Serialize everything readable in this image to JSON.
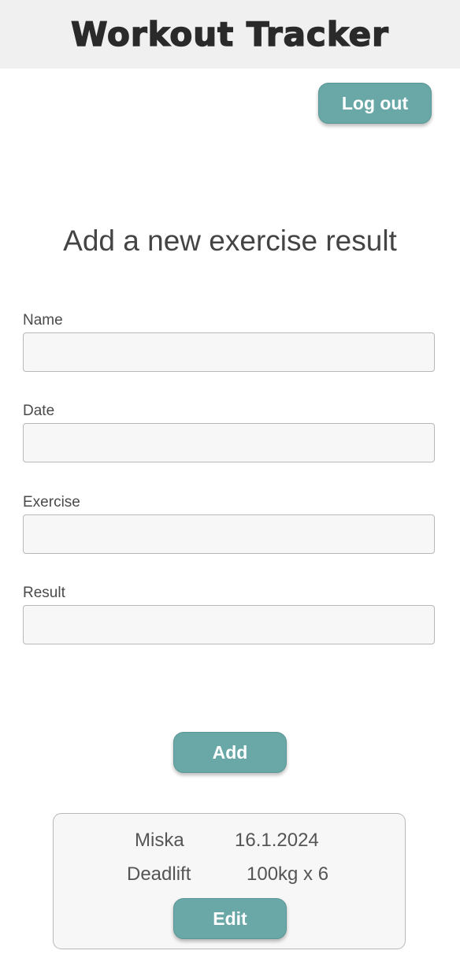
{
  "header": {
    "title": "Workout Tracker"
  },
  "auth": {
    "logout_label": "Log out"
  },
  "form": {
    "title": "Add a new exercise result",
    "fields": [
      {
        "label": "Name",
        "value": "",
        "placeholder": ""
      },
      {
        "label": "Date",
        "value": "",
        "placeholder": ""
      },
      {
        "label": "Exercise",
        "value": "",
        "placeholder": ""
      },
      {
        "label": "Result",
        "value": "",
        "placeholder": ""
      }
    ],
    "submit_label": "Add"
  },
  "results": [
    {
      "name": "Miska",
      "date": "16.1.2024",
      "exercise": "Deadlift",
      "result": "100kg x 6",
      "edit_label": "Edit"
    }
  ],
  "colors": {
    "accent": "#6aa8a8",
    "header_bg": "#f0f0f0",
    "input_bg": "#f7f7f7"
  }
}
